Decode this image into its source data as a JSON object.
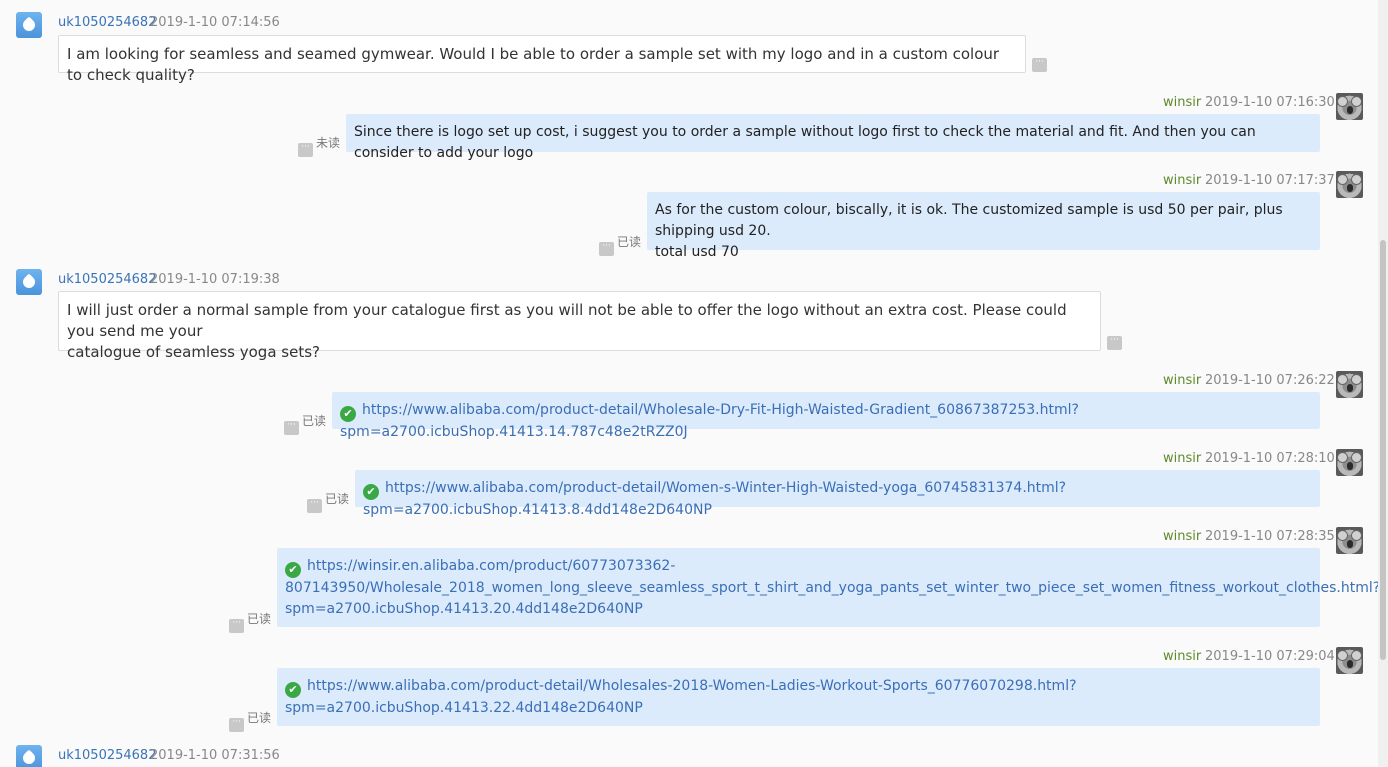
{
  "messages": {
    "m1": {
      "sender": "uk1050254682",
      "time": "2019-1-10 07:14:56",
      "text": "I am looking for seamless and seamed gymwear. Would I be able to order a sample set with my logo and in a custom colour to check quality?"
    },
    "m2": {
      "sender": "winsir",
      "time": "2019-1-10 07:16:30",
      "text": "Since there is logo set up cost, i suggest you to order a sample without logo first to check the material and fit. And then you can consider to add your logo",
      "status": "未读"
    },
    "m3": {
      "sender": "winsir",
      "time": "2019-1-10 07:17:37",
      "line1": "As for the custom colour, biscally, it is ok.  The customized sample is usd 50 per pair, plus shipping usd 20.",
      "line2": "total usd 70",
      "status": "已读"
    },
    "m4": {
      "sender": "uk1050254682",
      "time": "2019-1-10 07:19:38",
      "line1": "I will just order a normal sample from your catalogue first as you will not be able to offer the logo without an extra cost. Please could you send me your",
      "line2": "catalogue of seamless yoga sets?"
    },
    "m5": {
      "sender": "winsir",
      "time": "2019-1-10 07:26:22",
      "link": "https://www.alibaba.com/product-detail/Wholesale-Dry-Fit-High-Waisted-Gradient_60867387253.html?spm=a2700.icbuShop.41413.14.787c48e2tRZZ0J",
      "status": "已读"
    },
    "m6": {
      "sender": "winsir",
      "time": "2019-1-10 07:28:10",
      "link": "https://www.alibaba.com/product-detail/Women-s-Winter-High-Waisted-yoga_60745831374.html?spm=a2700.icbuShop.41413.8.4dd148e2D640NP",
      "status": "已读"
    },
    "m7": {
      "sender": "winsir",
      "time": "2019-1-10 07:28:35",
      "link_l1": "https://winsir.en.alibaba.com/product/60773073362-",
      "link_l2": "807143950/Wholesale_2018_women_long_sleeve_seamless_sport_t_shirt_and_yoga_pants_set_winter_two_piece_set_women_fitness_workout_clothes.html?",
      "link_l3": "spm=a2700.icbuShop.41413.20.4dd148e2D640NP",
      "status": "已读"
    },
    "m8": {
      "sender": "winsir",
      "time": "2019-1-10 07:29:04",
      "link_l1": "https://www.alibaba.com/product-detail/Wholesales-2018-Women-Ladies-Workout-Sports_60776070298.html?",
      "link_l2": "spm=a2700.icbuShop.41413.22.4dd148e2D640NP",
      "status": "已读"
    },
    "m9": {
      "sender": "uk1050254682",
      "time": "2019-1-10 07:31:56"
    }
  },
  "more_glyph": "···",
  "check_glyph": "✔",
  "colors": {
    "incoming_name": "#3a74b8",
    "outgoing_name": "#5d8a2b",
    "outgoing_bubble": "#dcebfc",
    "link": "#3a6fb6",
    "check": "#3aa845"
  }
}
